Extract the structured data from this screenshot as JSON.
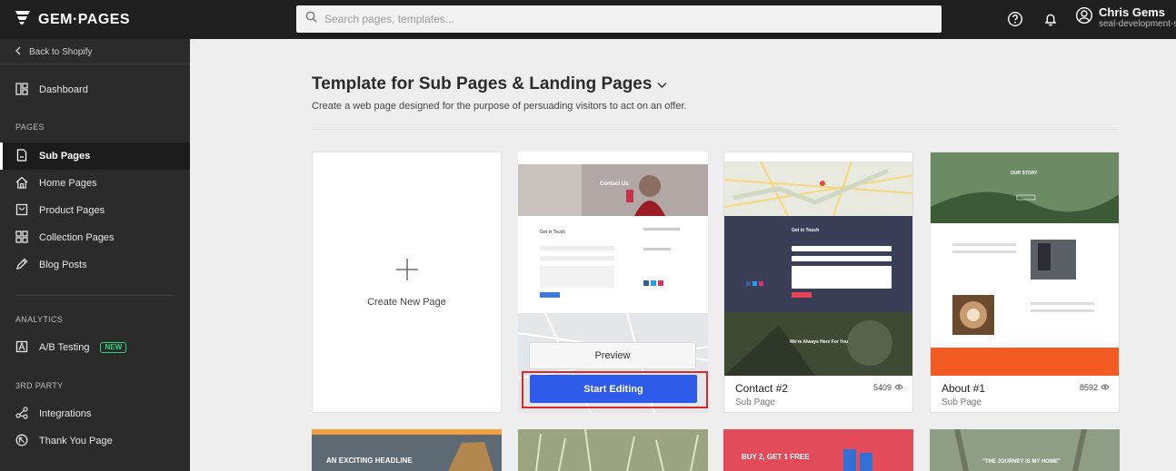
{
  "header": {
    "logo_text": "GEM·PAGES",
    "search_placeholder": "Search pages, templates...",
    "help_icon": "help-circle-icon",
    "notification_icon": "bell-icon",
    "user_name": "Chris Gems",
    "user_store": "seal-development-s"
  },
  "sidebar": {
    "back_label": "Back to Shopify",
    "dashboard_label": "Dashboard",
    "pages_section": "PAGES",
    "items": [
      {
        "label": "Sub Pages",
        "icon": "page-icon",
        "active": true
      },
      {
        "label": "Home Pages",
        "icon": "home-icon"
      },
      {
        "label": "Product Pages",
        "icon": "product-icon"
      },
      {
        "label": "Collection Pages",
        "icon": "grid-icon"
      },
      {
        "label": "Blog Posts",
        "icon": "pen-icon"
      }
    ],
    "analytics_section": "ANALYTICS",
    "ab_label": "A/B Testing",
    "ab_badge": "NEW",
    "third_party_section": "3RD PARTY",
    "integrations_label": "Integrations",
    "thankyou_label": "Thank You Page"
  },
  "main": {
    "title": "Template for Sub Pages & Landing Pages",
    "subtitle": "Create a web page designed for the purpose of persuading visitors to act on an offer.",
    "create_label": "Create New Page",
    "preview_label": "Preview",
    "start_editing_label": "Start Editing",
    "cards": [
      {
        "name": "Contact #2",
        "type": "Sub Page",
        "views": "5409"
      },
      {
        "name": "About #1",
        "type": "Sub Page",
        "views": "8592"
      }
    ],
    "thumb_texts": {
      "contact_hero": "Contact Us",
      "get_in_touch": "Get in Touch",
      "were_here": "We're Always Here For You",
      "our_story": "OUR STORY",
      "exciting": "AN EXCITING HEADLINE",
      "buy2": "BUY 2, GET 1 FREE",
      "journey": "\"THE JOURNEY IS MY HOME\""
    }
  },
  "colors": {
    "accent": "#2f5bea",
    "highlight": "#d92b2b",
    "sidebar_bg": "#2b2b2b",
    "topbar_bg": "#1f1f1f"
  }
}
